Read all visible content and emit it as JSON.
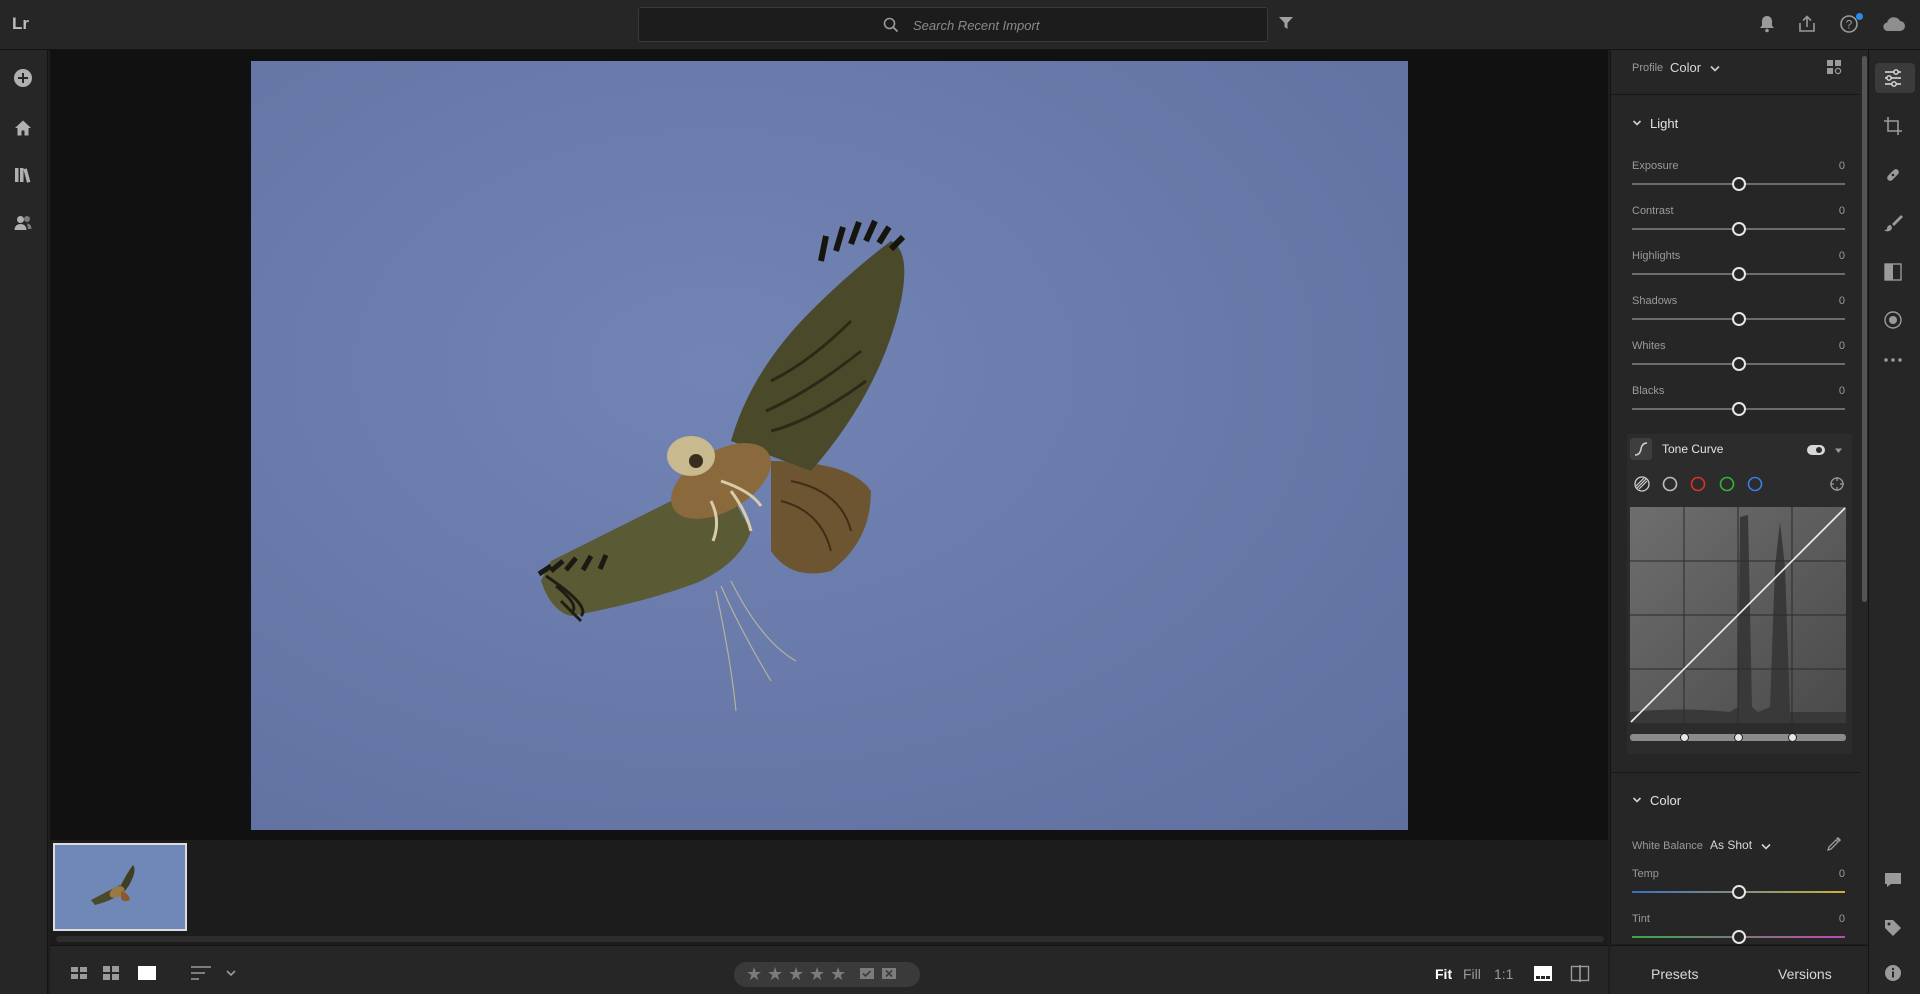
{
  "app": {
    "logo": "Lr"
  },
  "search": {
    "placeholder": "Search Recent Import"
  },
  "view": {
    "fit": "Fit",
    "fill": "Fill",
    "one_to_one": "1:1"
  },
  "rating": {
    "stars": 0,
    "max": 5
  },
  "edit_panel": {
    "profile_label": "Profile",
    "profile_value": "Color",
    "light": {
      "title": "Light",
      "sliders": [
        {
          "label": "Exposure",
          "value": "0"
        },
        {
          "label": "Contrast",
          "value": "0"
        },
        {
          "label": "Highlights",
          "value": "0"
        },
        {
          "label": "Shadows",
          "value": "0"
        },
        {
          "label": "Whites",
          "value": "0"
        },
        {
          "label": "Blacks",
          "value": "0"
        }
      ]
    },
    "tone_curve": {
      "title": "Tone Curve"
    },
    "color": {
      "title": "Color",
      "white_balance_label": "White Balance",
      "white_balance_value": "As Shot",
      "sliders": [
        {
          "label": "Temp",
          "value": "0"
        },
        {
          "label": "Tint",
          "value": "0"
        }
      ]
    }
  },
  "tabs": {
    "presets": "Presets",
    "versions": "Versions"
  },
  "colors": {
    "accent_blue": "#2d8ceb",
    "panel": "#262626",
    "sky": "#6a7bab"
  }
}
